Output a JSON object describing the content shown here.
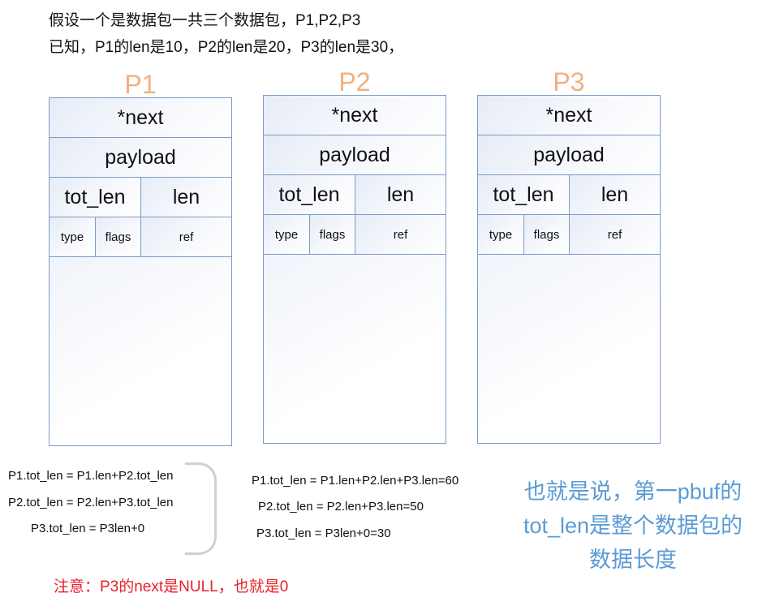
{
  "intro": {
    "line1": "假设一个是数据包一共三个数据包，P1,P2,P3",
    "line2": "已知，P1的len是10，P2的len是20，P3的len是30，"
  },
  "packets": [
    {
      "label": "P1",
      "next": "*next",
      "payload": "payload",
      "tot_len": "tot_len",
      "len": "len",
      "type": "type",
      "flags": "flags",
      "ref": "ref"
    },
    {
      "label": "P2",
      "next": "*next",
      "payload": "payload",
      "tot_len": "tot_len",
      "len": "len",
      "type": "type",
      "flags": "flags",
      "ref": "ref"
    },
    {
      "label": "P3",
      "next": "*next",
      "payload": "payload",
      "tot_len": "tot_len",
      "len": "len",
      "type": "type",
      "flags": "flags",
      "ref": "ref"
    }
  ],
  "formulas_general": [
    "P1.tot_len = P1.len+P2.tot_len",
    "P2.tot_len = P2.len+P3.tot_len",
    "P3.tot_len = P3len+0"
  ],
  "formulas_values": [
    "P1.tot_len = P1.len+P2.len+P3.len=60",
    "P2.tot_len = P2.len+P3.len=50",
    "P3.tot_len = P3len+0=30"
  ],
  "note": "注意：P3的next是NULL，也就是0",
  "summary": {
    "line1": "也就是说，第一pbuf的",
    "line2": "tot_len是整个数据包的",
    "line3": "数据长度"
  },
  "colors": {
    "packet_label": "#f2b07f",
    "box_border": "#7a9cc6",
    "note": "#e8202a",
    "summary": "#5b9bd5"
  }
}
